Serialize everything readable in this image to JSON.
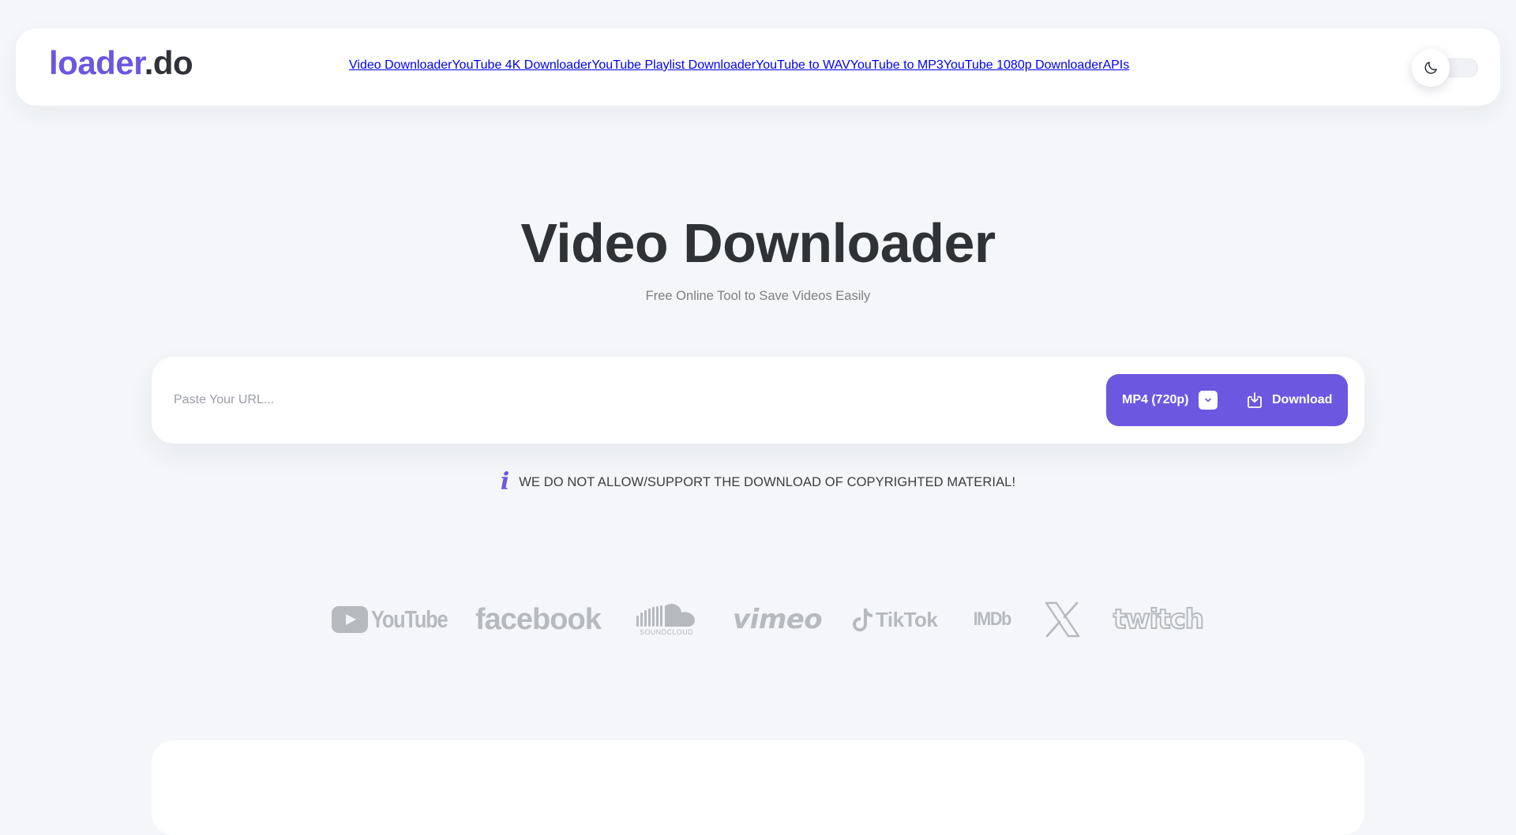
{
  "header": {
    "logo_main": "loader",
    "logo_suffix": ".do",
    "nav": [
      {
        "label": "Video Downloader"
      },
      {
        "label": "YouTube 4K Downloader"
      },
      {
        "label": "YouTube Playlist Downloader"
      },
      {
        "label": "YouTube to WAV"
      },
      {
        "label": "YouTube to MP3"
      },
      {
        "label": "YouTube 1080p Downloader"
      },
      {
        "label": "APIs"
      }
    ],
    "theme_toggle_icon": "moon-icon"
  },
  "hero": {
    "title": "Video Downloader",
    "subtitle": "Free Online Tool to Save Videos Easily"
  },
  "search": {
    "placeholder": "Paste Your URL...",
    "format_label": "MP4 (720p)",
    "download_label": "Download"
  },
  "notice": {
    "icon": "info-icon",
    "text": "WE DO NOT ALLOW/SUPPORT THE DOWNLOAD OF COPYRIGHTED MATERIAL!"
  },
  "platforms": {
    "youtube": "YouTube",
    "facebook": "facebook",
    "soundcloud": "SOUNDCLOUD",
    "vimeo": "vimeo",
    "tiktok": "TikTok",
    "imdb": "IMDb",
    "x": "X",
    "twitch": "twitch"
  },
  "colors": {
    "accent": "#6b57e0",
    "background": "#f4f6f9",
    "logo_gray": "#b6babf"
  }
}
